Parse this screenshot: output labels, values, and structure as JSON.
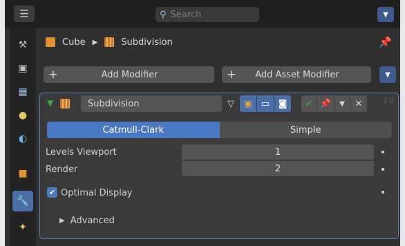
{
  "header": {
    "search_placeholder": "Search",
    "editor_type_icon": "properties-editor-icon",
    "menu_icon": "chevron-down-icon"
  },
  "sidebar": {
    "tabs": [
      {
        "name": "tool",
        "icon": "tool-icon"
      },
      {
        "name": "render",
        "icon": "render-icon"
      },
      {
        "name": "output",
        "icon": "output-icon"
      },
      {
        "name": "view-layer",
        "icon": "view-layer-icon"
      },
      {
        "name": "scene",
        "icon": "scene-icon"
      },
      {
        "name": "world",
        "icon": "world-icon"
      },
      {
        "name": "object",
        "icon": "object-icon"
      },
      {
        "name": "modifiers",
        "icon": "wrench-icon",
        "active": true
      },
      {
        "name": "particles",
        "icon": "particles-icon"
      }
    ]
  },
  "breadcrumb": {
    "object": "Cube",
    "modifier": "Subdivision"
  },
  "actions": {
    "add_modifier": "Add Modifier",
    "add_asset_modifier": "Add Asset Modifier",
    "plus": "+"
  },
  "modifier": {
    "name": "Subdivision",
    "mode_tabs": {
      "active": "Catmull-Clark",
      "inactive": "Simple"
    },
    "fields": [
      {
        "label": "Levels Viewport",
        "value": "1"
      },
      {
        "label": "Render",
        "value": "2"
      }
    ],
    "optimal_display": {
      "label": "Optimal Display",
      "checked": true
    },
    "advanced_label": "Advanced"
  },
  "colors": {
    "accent": "#4a78c2",
    "panel_bg": "#3a3a3a",
    "apply_green": "#3ea54d"
  }
}
